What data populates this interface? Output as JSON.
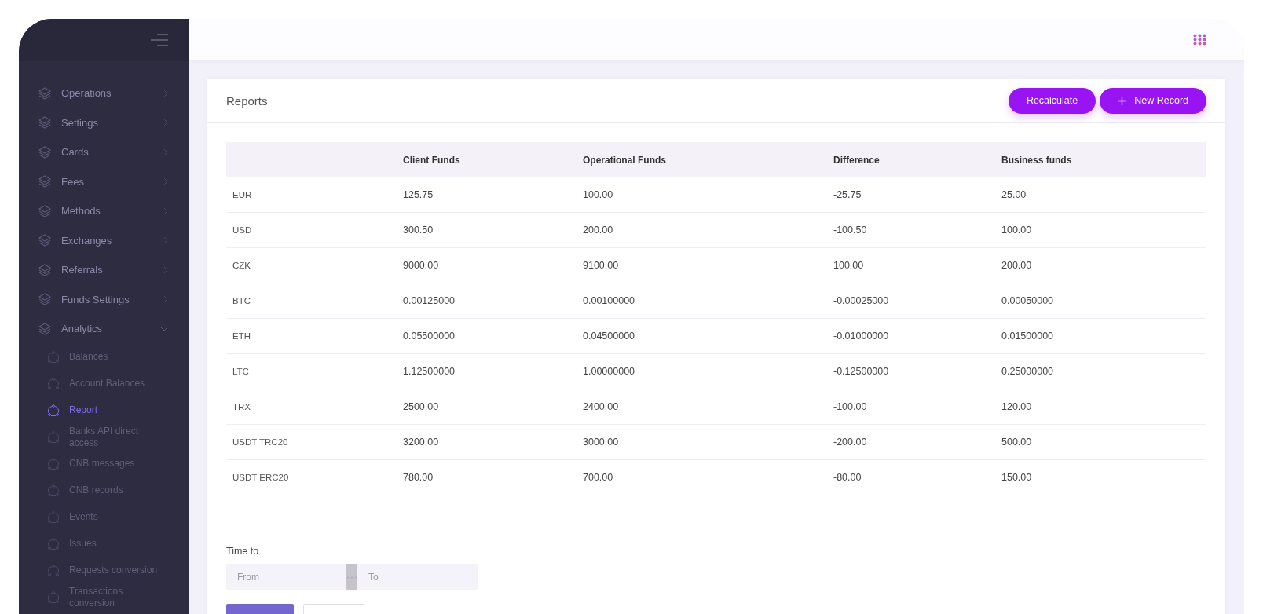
{
  "sidebar": {
    "items": [
      {
        "label": "Operations",
        "expanded": false
      },
      {
        "label": "Settings",
        "expanded": false
      },
      {
        "label": "Cards",
        "expanded": false
      },
      {
        "label": "Fees",
        "expanded": false
      },
      {
        "label": "Methods",
        "expanded": false
      },
      {
        "label": "Exchanges",
        "expanded": false
      },
      {
        "label": "Referrals",
        "expanded": false
      },
      {
        "label": "Funds Settings",
        "expanded": false
      },
      {
        "label": "Analytics",
        "expanded": true,
        "children": [
          {
            "label": "Balances",
            "selected": false
          },
          {
            "label": "Account Balances",
            "selected": false
          },
          {
            "label": "Report",
            "selected": true
          },
          {
            "label": "Banks API direct access",
            "selected": false
          },
          {
            "label": "CNB messages",
            "selected": false
          },
          {
            "label": "CNB records",
            "selected": false
          },
          {
            "label": "Events",
            "selected": false
          },
          {
            "label": "Issues",
            "selected": false
          },
          {
            "label": "Requests conversion",
            "selected": false
          },
          {
            "label": "Transactions conversion",
            "selected": false
          }
        ]
      }
    ]
  },
  "card": {
    "title": "Reports",
    "buttons": [
      {
        "label": "Recalculate",
        "kind": "plain"
      },
      {
        "label": "New Record",
        "kind": "add"
      }
    ]
  },
  "table": {
    "columns": [
      "",
      "Client Funds",
      "Operational Funds",
      "Difference",
      "Business funds"
    ],
    "rows": [
      [
        "EUR",
        "125.75",
        "100.00",
        "-25.75",
        "25.00"
      ],
      [
        "USD",
        "300.50",
        "200.00",
        "-100.50",
        "100.00"
      ],
      [
        "CZK",
        "9000.00",
        "9100.00",
        "100.00",
        "200.00"
      ],
      [
        "BTC",
        "0.00125000",
        "0.00100000",
        "-0.00025000",
        "0.00050000"
      ],
      [
        "ETH",
        "0.05500000",
        "0.04500000",
        "-0.01000000",
        "0.01500000"
      ],
      [
        "LTC",
        "1.12500000",
        "1.00000000",
        "-0.12500000",
        "0.25000000"
      ],
      [
        "TRX",
        "2500.00",
        "2400.00",
        "-100.00",
        "120.00"
      ],
      [
        "USDT TRC20",
        "3200.00",
        "3000.00",
        "-200.00",
        "500.00"
      ],
      [
        "USDT ERC20",
        "780.00",
        "700.00",
        "-80.00",
        "150.00"
      ]
    ]
  },
  "date_range": {
    "label": "Time to",
    "from": {
      "placeholder": "From"
    },
    "to": {
      "placeholder": "To"
    }
  }
}
